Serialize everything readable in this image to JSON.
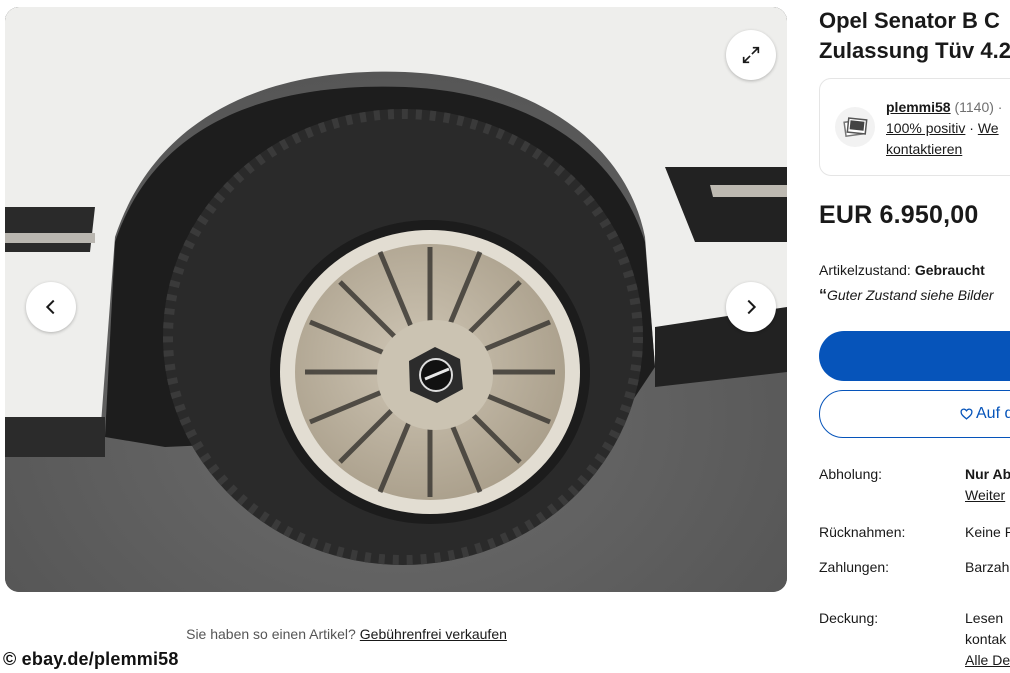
{
  "gallery": {
    "image_alt": "Opel Senator B wheel with BBS-style mesh rim",
    "expand_icon": "expand-arrows-icon",
    "prev_icon": "chevron-left-icon",
    "next_icon": "chevron-right-icon"
  },
  "sell_prompt": "Sie haben so einen Artikel?",
  "sell_link": "Gebührenfrei verkaufen",
  "copyright": "© ebay.de/plemmi58",
  "listing": {
    "title_line1": "Opel Senator B C",
    "title_line2": "Zulassung Tüv 4.2",
    "price": "EUR 6.950,00",
    "condition_label": "Artikelzustand:",
    "condition_value": "Gebraucht",
    "condition_quote_mark": "“",
    "condition_note": "Guter Zustand siehe Bilder"
  },
  "seller": {
    "name": "plemmi58",
    "count": "(1140)",
    "sep": " ·",
    "positive": "100% positiv",
    "dot": " · ",
    "more": "We",
    "contact": "kontaktieren"
  },
  "buttons": {
    "buy_label": "",
    "watch_label": "Auf d",
    "watch_icon": "heart-icon"
  },
  "details": [
    {
      "label": "Abholung:",
      "value1": "Nur Ab",
      "value2": "Weiter"
    },
    {
      "label": "Rücknahmen:",
      "value1": "Keine R"
    },
    {
      "label": "Zahlungen:",
      "value1": "Barzah"
    },
    {
      "label": "Deckung:",
      "value1": "Lesen",
      "value2": "kontak",
      "value3": "Alle De"
    }
  ],
  "colors": {
    "brand_blue": "#0654ba",
    "text": "#191919",
    "muted": "#707070"
  }
}
